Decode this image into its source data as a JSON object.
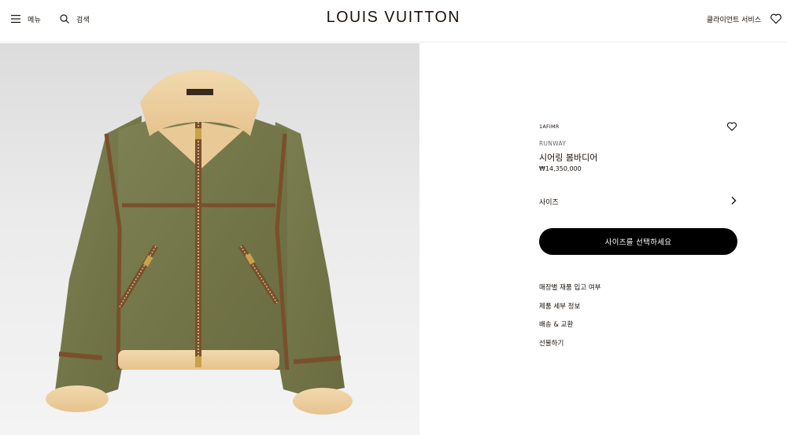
{
  "header": {
    "menu_label": "메뉴",
    "search_label": "검색",
    "logo": "LOUIS VUITTON",
    "client_service": "클라이언트 서비스",
    "menu_icon": "hamburger-icon",
    "search_icon": "search-icon",
    "wishlist_icon": "heart-icon"
  },
  "product": {
    "sku": "1AFIMR",
    "collection": "RUNWAY",
    "name": "시어링 봄바디어",
    "price": "₩14,350,000",
    "size_label": "사이즈",
    "select_size_button": "사이즈를 선택하세요",
    "links": [
      "매장별 재품 입고 여부",
      "제품 세부 정보",
      "배송 & 교환",
      "선물하기"
    ]
  },
  "colors": {
    "accent": "#000000",
    "text": "#19110b"
  }
}
